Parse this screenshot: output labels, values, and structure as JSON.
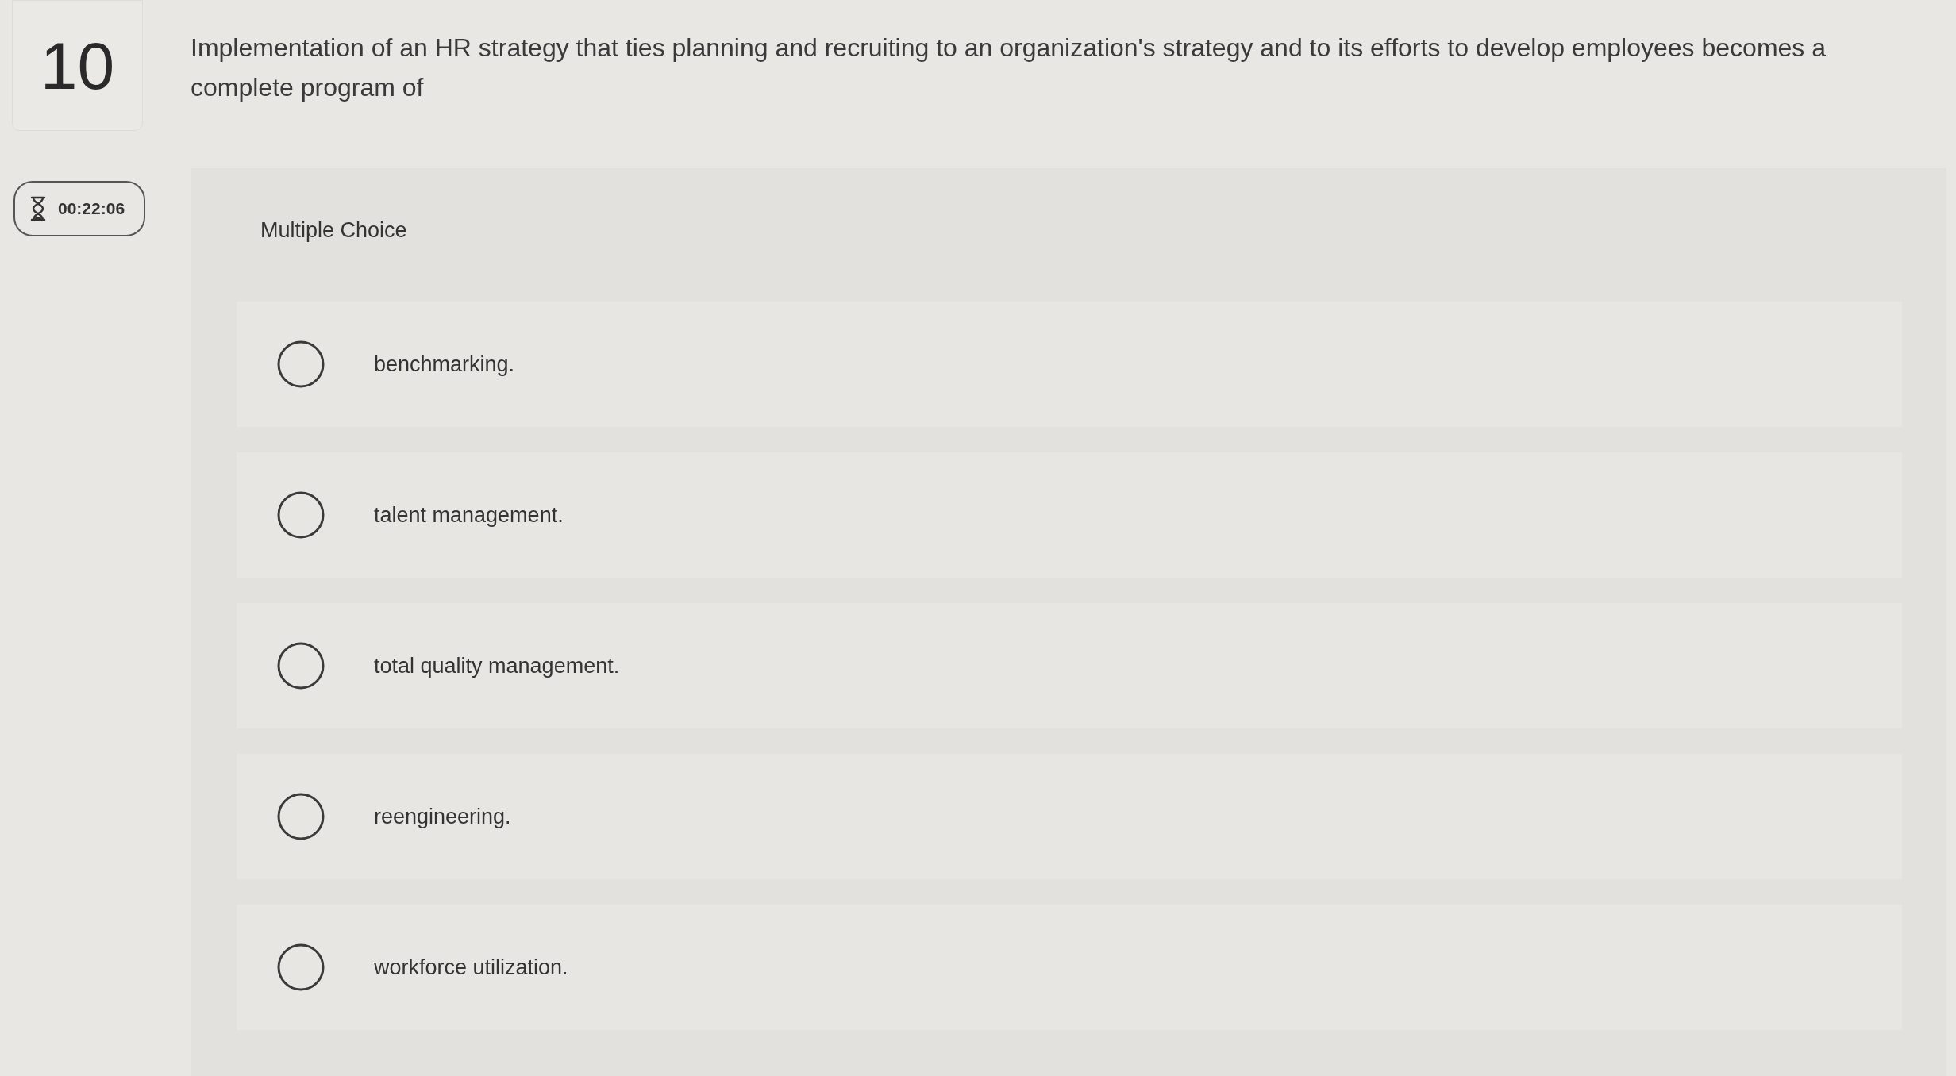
{
  "question": {
    "number": "10",
    "timer": "00:22:06",
    "text": "Implementation of an HR strategy that ties planning and recruiting to an organization's strategy and to its efforts to develop employees becomes a complete program of"
  },
  "answer_panel": {
    "type_label": "Multiple Choice",
    "choices": [
      {
        "label": "benchmarking.",
        "selected": false
      },
      {
        "label": "talent management.",
        "selected": false
      },
      {
        "label": "total quality management.",
        "selected": false
      },
      {
        "label": "reengineering.",
        "selected": false
      },
      {
        "label": "workforce utilization.",
        "selected": false
      }
    ]
  }
}
